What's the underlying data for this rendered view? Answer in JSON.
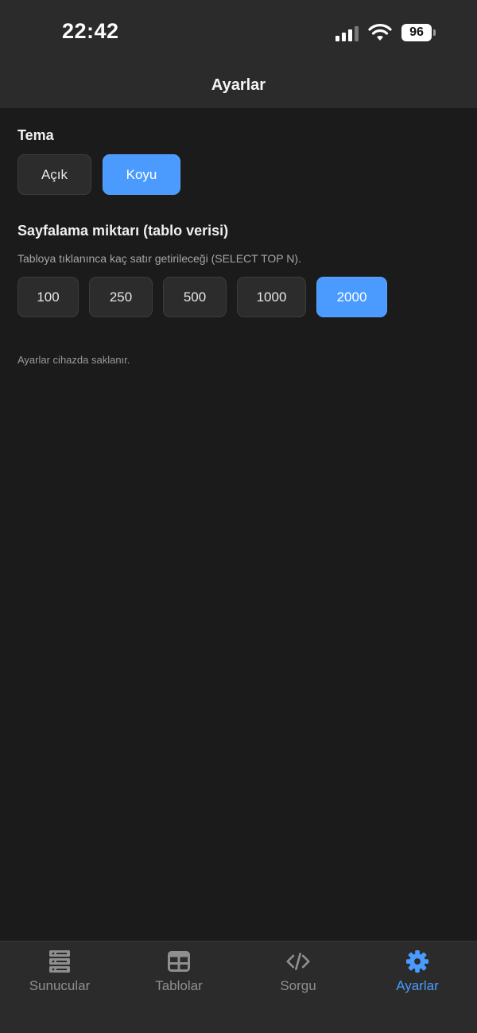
{
  "status_bar": {
    "time": "22:42",
    "battery": "96"
  },
  "header": {
    "title": "Ayarlar"
  },
  "theme": {
    "title": "Tema",
    "options": [
      {
        "label": "Açık",
        "selected": false
      },
      {
        "label": "Koyu",
        "selected": true
      }
    ]
  },
  "paging": {
    "title": "Sayfalama miktarı (tablo verisi)",
    "description": "Tabloya tıklanınca kaç satır getirileceği (SELECT TOP N).",
    "options": [
      {
        "label": "100",
        "selected": false
      },
      {
        "label": "250",
        "selected": false
      },
      {
        "label": "500",
        "selected": false
      },
      {
        "label": "1000",
        "selected": false
      },
      {
        "label": "2000",
        "selected": true
      }
    ]
  },
  "note": "Ayarlar cihazda saklanır.",
  "tabbar": {
    "items": [
      {
        "label": "Sunucular",
        "icon": "server-icon",
        "active": false
      },
      {
        "label": "Tablolar",
        "icon": "table-icon",
        "active": false
      },
      {
        "label": "Sorgu",
        "icon": "code-icon",
        "active": false
      },
      {
        "label": "Ayarlar",
        "icon": "gear-icon",
        "active": true
      }
    ]
  },
  "colors": {
    "accent": "#4b9bff",
    "background": "#1b1b1b",
    "surface": "#2b2b2b",
    "inactive_tab": "#8f8f8f"
  }
}
